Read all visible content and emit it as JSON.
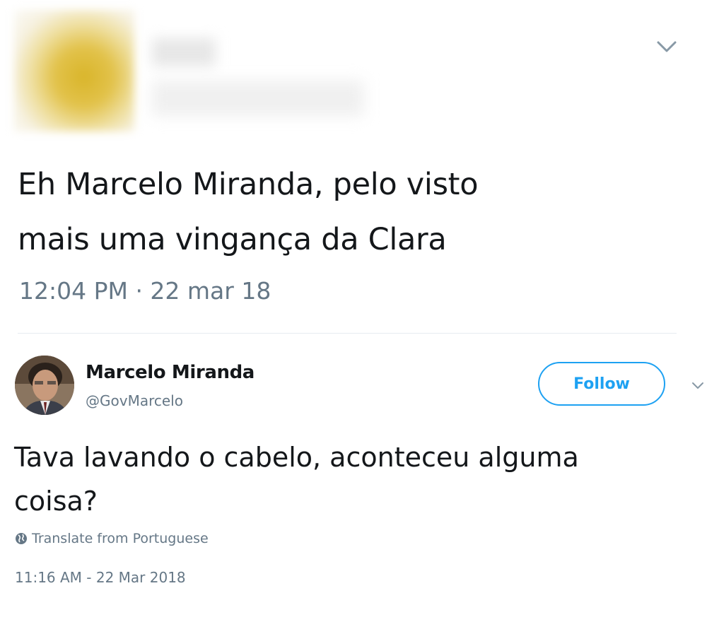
{
  "outer_tweet": {
    "text_line1": "Eh Marcelo Miranda, pelo visto",
    "text_line2": "mais uma vingança da Clara",
    "timestamp": "12:04 PM · 22 mar 18",
    "menu_icon": "chevron-down-icon"
  },
  "embedded_tweet": {
    "author_name": "Marcelo Miranda",
    "author_handle": "@GovMarcelo",
    "follow_label": "Follow",
    "text_line1": "Tava lavando o cabelo, aconteceu alguma",
    "text_line2": "coisa?",
    "translate_label": "Translate from Portuguese",
    "timestamp": "11:16 AM - 22 Mar 2018",
    "menu_icon": "chevron-down-icon",
    "globe_icon": "globe-icon"
  },
  "colors": {
    "text": "#14171a",
    "secondary": "#657786",
    "accent": "#1da1f2",
    "divider": "#e6ecf0"
  }
}
